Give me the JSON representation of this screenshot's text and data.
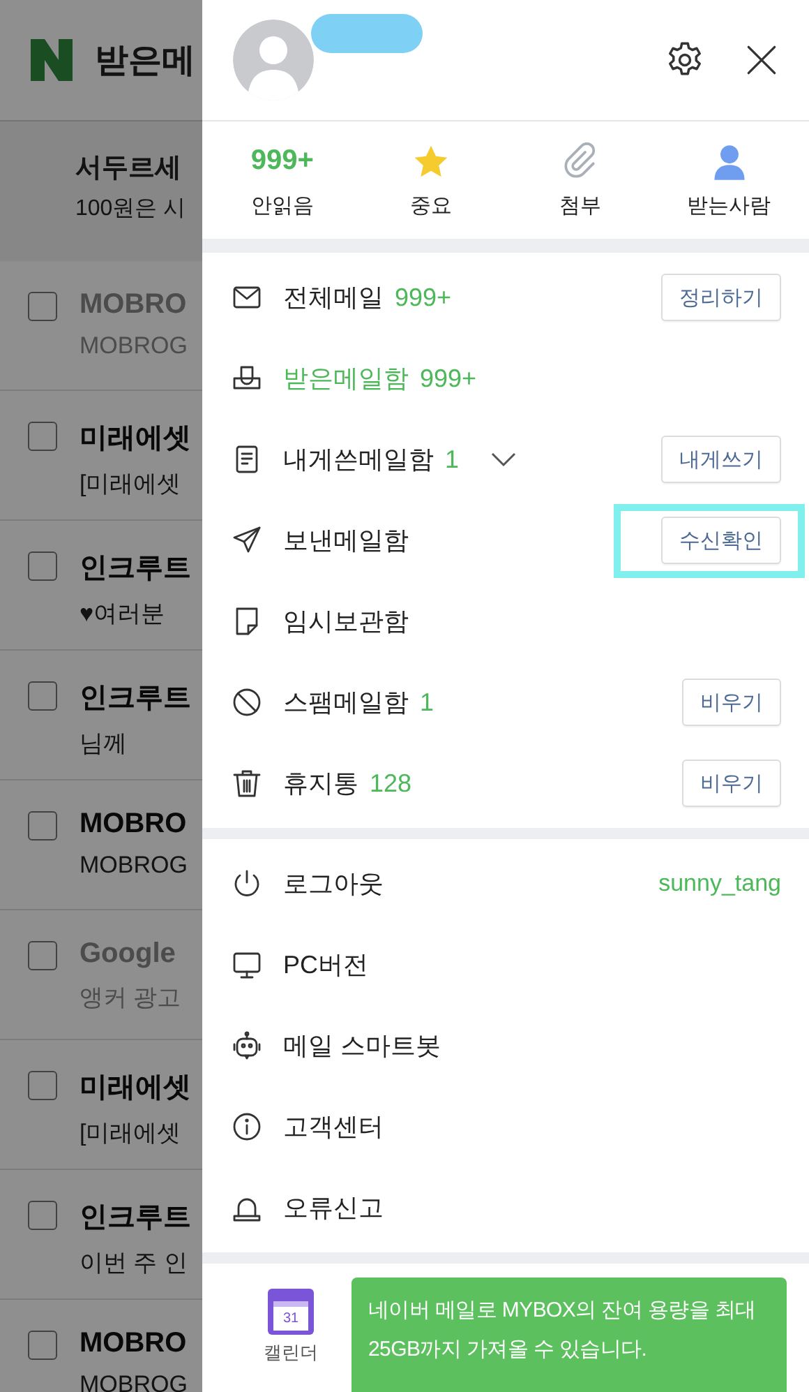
{
  "mail_list": {
    "header": {
      "title": "받은메"
    },
    "promo": {
      "title": "서두르세",
      "preview": "100원은 시"
    },
    "rows": [
      {
        "title": "MOBRO",
        "preview": "MOBROG",
        "read": true
      },
      {
        "title": "미래에셋",
        "preview": "[미래에셋",
        "read": false
      },
      {
        "title": "인크루트",
        "preview": "♥여러분",
        "read": false
      },
      {
        "title": "인크루트",
        "preview": "님께",
        "read": false
      },
      {
        "title": "MOBRO",
        "preview": "MOBROG",
        "read": false
      },
      {
        "title": "Google",
        "preview": "앵커 광고",
        "read": true
      },
      {
        "title": "미래에셋",
        "preview": "[미래에셋",
        "read": false
      },
      {
        "title": "인크루트",
        "preview": "이번 주 인",
        "read": false
      },
      {
        "title": "MOBRO",
        "preview": "MOBROG",
        "read": false
      }
    ]
  },
  "drawer": {
    "quick": [
      {
        "kind": "count",
        "count": "999+",
        "label": "안읽음"
      },
      {
        "kind": "star",
        "label": "중요"
      },
      {
        "kind": "clip",
        "label": "첨부"
      },
      {
        "kind": "person",
        "label": "받는사람"
      }
    ],
    "folders": [
      {
        "kind": "mail",
        "label": "전체메일",
        "count": "999+",
        "selected": false,
        "button": "정리하기"
      },
      {
        "kind": "inbox",
        "label": "받은메일함",
        "count": "999+",
        "selected": true
      },
      {
        "kind": "note",
        "label": "내게쓴메일함",
        "count": "1",
        "selected": false,
        "expanded": false,
        "button": "내게쓰기"
      },
      {
        "kind": "send",
        "label": "보낸메일함",
        "selected": false,
        "button": "수신확인",
        "highlighted": true
      },
      {
        "kind": "draft",
        "label": "임시보관함",
        "selected": false
      },
      {
        "kind": "spam",
        "label": "스팸메일함",
        "count": "1",
        "selected": false,
        "button": "비우기"
      },
      {
        "kind": "trash",
        "label": "휴지통",
        "count": "128",
        "selected": false,
        "button": "비우기"
      }
    ],
    "tools": [
      {
        "kind": "power",
        "label": "로그아웃",
        "account": "sunny_tang"
      },
      {
        "kind": "monitor",
        "label": "PC버전"
      },
      {
        "kind": "robot",
        "label": "메일 스마트봇"
      },
      {
        "kind": "info",
        "label": "고객센터"
      },
      {
        "kind": "bell",
        "label": "오류신고"
      }
    ],
    "footer": {
      "calendar_day": "31",
      "calendar_label": "캘린더",
      "banner": "네이버 메일로 MYBOX의 잔여 용량을 최대 25GB까지 가져올 수 있습니다."
    }
  }
}
